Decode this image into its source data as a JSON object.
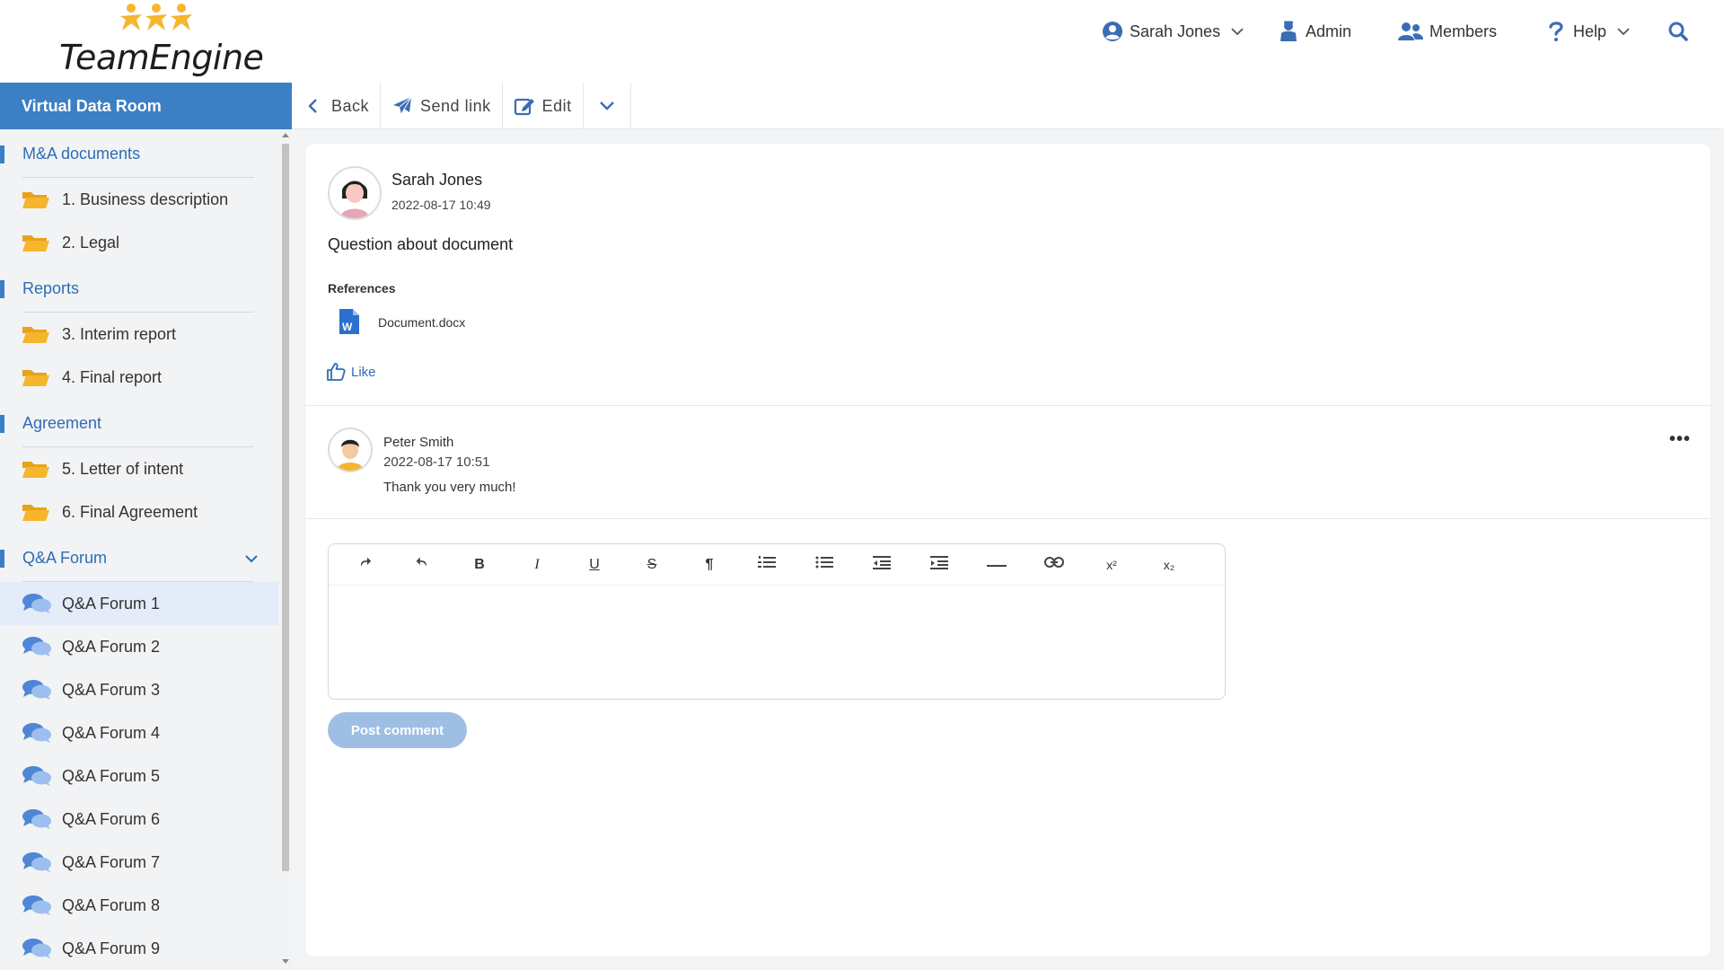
{
  "app": {
    "logo_text": "TeamEngine"
  },
  "topnav": {
    "user": "Sarah Jones",
    "admin": "Admin",
    "members": "Members",
    "help": "Help"
  },
  "sidebar": {
    "title": "Virtual Data Room",
    "sections": [
      {
        "label": "M&A documents",
        "items": [
          "1. Business description",
          "2. Legal"
        ]
      },
      {
        "label": "Reports",
        "items": [
          "3. Interim report",
          "4. Final report"
        ]
      },
      {
        "label": "Agreement",
        "items": [
          "5. Letter of intent",
          "6. Final Agreement"
        ]
      },
      {
        "label": "Q&A Forum",
        "items": [
          "Q&A Forum 1",
          "Q&A Forum 2",
          "Q&A Forum 3",
          "Q&A Forum 4",
          "Q&A Forum 5",
          "Q&A Forum 6",
          "Q&A Forum 7",
          "Q&A Forum 8",
          "Q&A Forum 9"
        ]
      }
    ],
    "active_item": "Q&A Forum 1"
  },
  "toolbar": {
    "back": "Back",
    "send_link": "Send link",
    "edit": "Edit"
  },
  "post": {
    "author": "Sarah Jones",
    "timestamp": "2022-08-17 10:49",
    "title": "Question about document",
    "references_label": "References",
    "reference_file": "Document.docx",
    "like_label": "Like"
  },
  "comment": {
    "author": "Peter Smith",
    "timestamp": "2022-08-17 10:51",
    "text": "Thank you very much!",
    "more_label": "•••"
  },
  "editor": {
    "buttons": [
      "redo",
      "undo",
      "bold",
      "italic",
      "underline",
      "strikethrough",
      "paragraph",
      "ordered-list",
      "unordered-list",
      "outdent",
      "indent",
      "horizontal-rule",
      "link",
      "superscript",
      "subscript"
    ],
    "labels": {
      "bold": "B",
      "italic": "I",
      "underline": "U",
      "strike": "S",
      "paragraph": "¶",
      "sup": "x²",
      "sub": "x₂"
    },
    "post_button": "Post comment"
  },
  "colors": {
    "brand": "#3b7fc4",
    "link": "#2d6db5",
    "folder": "#f5b62c",
    "forum_icon": "#4f86d6",
    "post_button_disabled": "#9ebfe3"
  }
}
